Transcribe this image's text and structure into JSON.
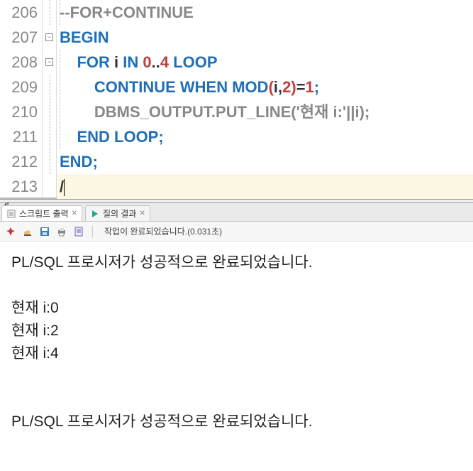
{
  "editor": {
    "lines": [
      {
        "num": "206",
        "fold": "line",
        "tokens": [
          {
            "t": "--FOR+CONTINUE",
            "c": "c-comment"
          }
        ],
        "indent": 1
      },
      {
        "num": "207",
        "fold": "minus",
        "tokens": [
          {
            "t": "BEGIN",
            "c": "c-keyword"
          }
        ],
        "indent": 0
      },
      {
        "num": "208",
        "fold": "minus",
        "tokens": [
          {
            "t": "    ",
            "c": ""
          },
          {
            "t": "FOR",
            "c": "c-keyword"
          },
          {
            "t": " i ",
            "c": "c-plain"
          },
          {
            "t": "IN",
            "c": "c-keyword"
          },
          {
            "t": " ",
            "c": ""
          },
          {
            "t": "0",
            "c": "c-number"
          },
          {
            "t": "..",
            "c": "c-plain"
          },
          {
            "t": "4",
            "c": "c-number"
          },
          {
            "t": " ",
            "c": ""
          },
          {
            "t": "LOOP",
            "c": "c-keyword"
          }
        ],
        "indent": 1
      },
      {
        "num": "209",
        "fold": "line",
        "tokens": [
          {
            "t": "        ",
            "c": ""
          },
          {
            "t": "CONTINUE WHEN MOD",
            "c": "c-keyword"
          },
          {
            "t": "(",
            "c": "c-paren"
          },
          {
            "t": "i",
            "c": "c-plain"
          },
          {
            "t": ",",
            "c": "c-plain"
          },
          {
            "t": "2",
            "c": "c-number"
          },
          {
            "t": ")",
            "c": "c-paren"
          },
          {
            "t": "=",
            "c": "c-plain"
          },
          {
            "t": "1",
            "c": "c-number"
          },
          {
            "t": ";",
            "c": "c-punct"
          }
        ],
        "indent": 1
      },
      {
        "num": "210",
        "fold": "line",
        "tokens": [
          {
            "t": "        ",
            "c": ""
          },
          {
            "t": "DBMS_OUTPUT.PUT_LINE('현재 i:'||i);",
            "c": "c-comment"
          }
        ],
        "indent": 1
      },
      {
        "num": "211",
        "fold": "line",
        "tokens": [
          {
            "t": "    ",
            "c": ""
          },
          {
            "t": "END LOOP",
            "c": "c-keyword"
          },
          {
            "t": ";",
            "c": "c-punct"
          }
        ],
        "indent": 1
      },
      {
        "num": "212",
        "fold": "line",
        "tokens": [
          {
            "t": "END",
            "c": "c-keyword"
          },
          {
            "t": ";",
            "c": "c-punct"
          }
        ],
        "indent": 0
      },
      {
        "num": "213",
        "fold": "none",
        "tokens": [
          {
            "t": "/",
            "c": "c-plain"
          }
        ],
        "indent": 0,
        "current": true
      }
    ]
  },
  "tabs": [
    {
      "label": "스크립트 출력",
      "active": true,
      "icon": "script"
    },
    {
      "label": "질의 결과",
      "active": false,
      "icon": "play"
    }
  ],
  "toolbar": {
    "status": "작업이 완료되었습니다.(0.031초)"
  },
  "output": [
    "PL/SQL 프로시저가 성공적으로 완료되었습니다.",
    "",
    "현재 i:0",
    "현재 i:2",
    "현재 i:4",
    "",
    "",
    "PL/SQL 프로시저가 성공적으로 완료되었습니다."
  ]
}
